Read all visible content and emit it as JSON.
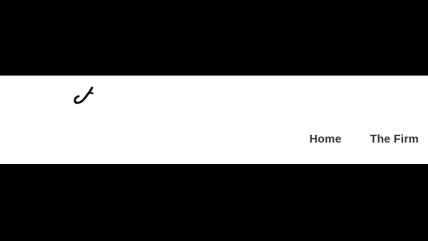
{
  "header": {
    "logo_icon": "hook-logo-icon",
    "nav": [
      {
        "label": "Home"
      },
      {
        "label": "The Firm"
      }
    ]
  },
  "colors": {
    "header_background": "#ffffff",
    "letterbox": "#000000",
    "nav_text": "#333333",
    "logo_stroke": "#111111"
  }
}
